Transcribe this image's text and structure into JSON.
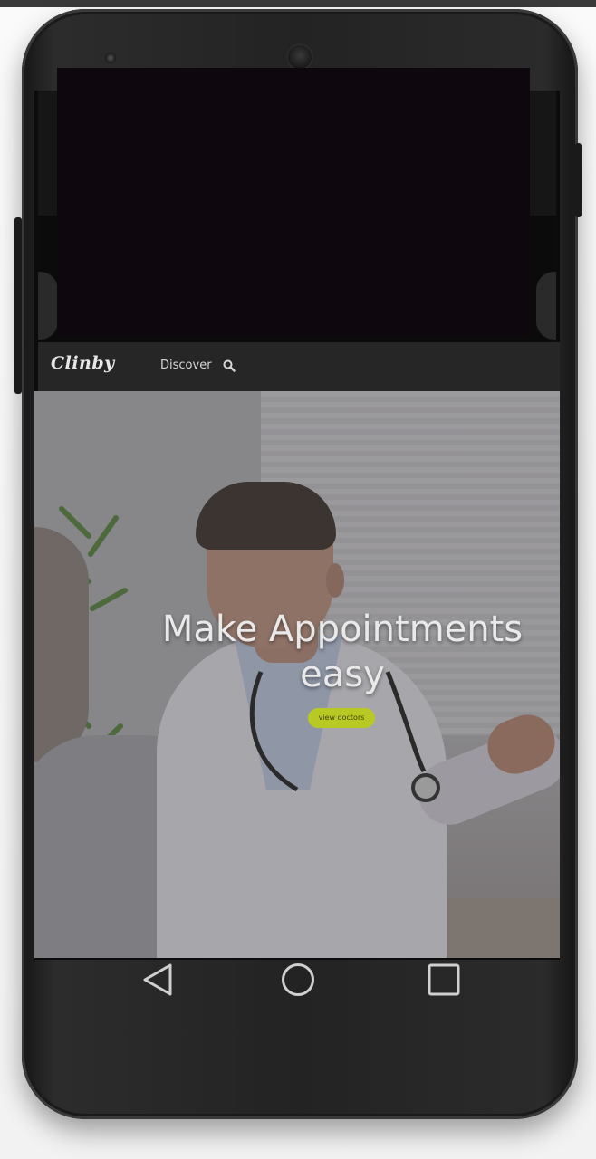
{
  "app": {
    "logo": "Clinby",
    "nav": {
      "discover_label": "Discover"
    }
  },
  "hero": {
    "title": "Make Appointments easy",
    "button_label": "view doctors"
  },
  "colors": {
    "navbar": "#262626",
    "accent": "#b9c924",
    "device": "#232323"
  },
  "system_nav": {
    "back_icon": "triangle-back-icon",
    "home_icon": "circle-home-icon",
    "recents_icon": "square-recents-icon"
  }
}
